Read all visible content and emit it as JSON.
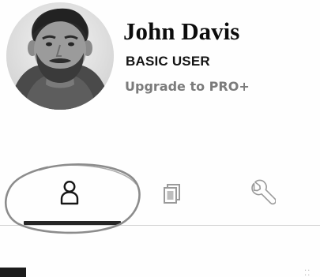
{
  "profile": {
    "name": "John Davis",
    "plan": "BASIC USER",
    "upgrade_label": "Upgrade to PRO+"
  },
  "tabs": [
    {
      "id": "profile",
      "icon": "person-icon",
      "active": true,
      "highlighted": true
    },
    {
      "id": "cards",
      "icon": "cards-icon",
      "active": false
    },
    {
      "id": "settings",
      "icon": "wrench-icon",
      "active": false
    }
  ],
  "colors": {
    "text_primary": "#0c0c0c",
    "text_secondary": "#7b7b7b",
    "active_underline": "#262626",
    "highlight_ring": "#8c8c8c",
    "icon_inactive": "#9a9a9a"
  }
}
